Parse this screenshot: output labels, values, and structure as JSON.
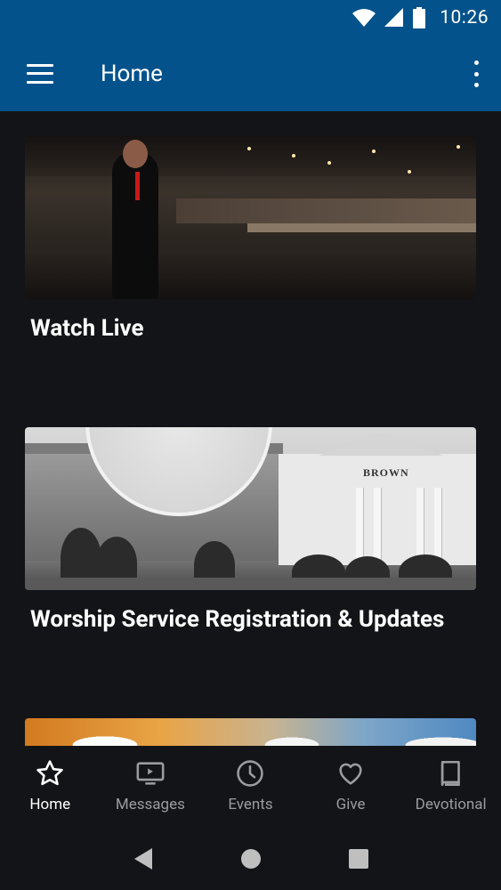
{
  "status": {
    "time": "10:26",
    "icons": [
      "wifi-icon",
      "signal-icon",
      "battery-icon"
    ]
  },
  "app_bar": {
    "title": "Home",
    "menu_icon": "menu-icon",
    "overflow_icon": "more-vert-icon"
  },
  "cards": [
    {
      "title": "Watch Live",
      "image": "auditorium-photo"
    },
    {
      "title": "Worship Service Registration & Updates",
      "image": "church-building-photo",
      "image_sign": "BROWN"
    },
    {
      "title": "",
      "image": "sky-photo"
    }
  ],
  "bottom_nav": {
    "items": [
      {
        "label": "Home",
        "icon": "star-icon",
        "active": true
      },
      {
        "label": "Messages",
        "icon": "tv-play-icon",
        "active": false
      },
      {
        "label": "Events",
        "icon": "clock-icon",
        "active": false
      },
      {
        "label": "Give",
        "icon": "heart-icon",
        "active": false
      },
      {
        "label": "Devotional",
        "icon": "book-icon",
        "active": false
      }
    ]
  },
  "system_nav": [
    "back-icon",
    "home-circle-icon",
    "recents-square-icon"
  ],
  "colors": {
    "primary": "#04528b",
    "background": "#131417",
    "nav_active": "#ffffff",
    "nav_inactive": "#9b9c9f"
  }
}
